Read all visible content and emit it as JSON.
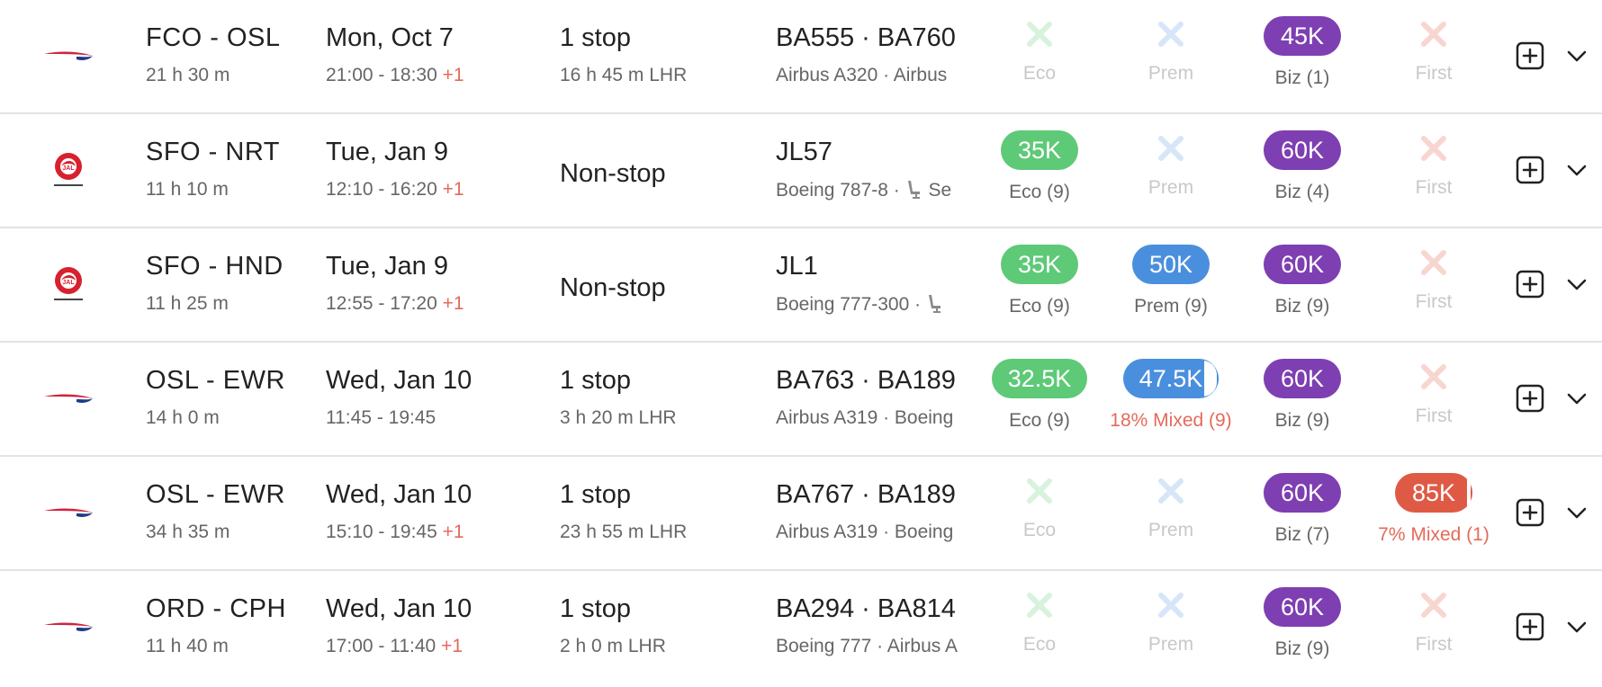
{
  "colors": {
    "eco": "#5ec977",
    "prem": "#4a8fdd",
    "biz": "#7e3fb2",
    "first": "#df5a45",
    "plus_day": "#e46a5a"
  },
  "rows": [
    {
      "airline_logo": "british-airways-logo",
      "route": "FCO - OSL",
      "duration": "21 h 30 m",
      "date": "Mon, Oct 7",
      "time_range": "21:00 - 18:30",
      "day_offset": "+1",
      "stops": "1 stop",
      "layover": "16 h 45 m  LHR",
      "flights": "BA555  ·  BA760",
      "aircraft": "Airbus A320  ·  Airbus",
      "cabins": {
        "eco": {
          "available": false,
          "label": "Eco"
        },
        "prem": {
          "available": false,
          "label": "Prem"
        },
        "biz": {
          "available": true,
          "price": "45K",
          "label": "Biz (1)"
        },
        "first": {
          "available": false,
          "label": "First"
        }
      }
    },
    {
      "airline_logo": "japan-airlines-logo",
      "route": "SFO - NRT",
      "duration": "11 h 10 m",
      "date": "Tue, Jan 9",
      "time_range": "12:10 - 16:20",
      "day_offset": "+1",
      "stops": "Non-stop",
      "layover": "",
      "flights": "JL57",
      "aircraft": "Boeing 787-8  ·",
      "aircraft_extra": "Se",
      "cabins": {
        "eco": {
          "available": true,
          "price": "35K",
          "label": "Eco (9)"
        },
        "prem": {
          "available": false,
          "label": "Prem"
        },
        "biz": {
          "available": true,
          "price": "60K",
          "label": "Biz (4)"
        },
        "first": {
          "available": false,
          "label": "First"
        }
      }
    },
    {
      "airline_logo": "japan-airlines-logo",
      "route": "SFO - HND",
      "duration": "11 h 25 m",
      "date": "Tue, Jan 9",
      "time_range": "12:55 - 17:20",
      "day_offset": "+1",
      "stops": "Non-stop",
      "layover": "",
      "flights": "JL1",
      "aircraft": "Boeing 777-300  ·",
      "aircraft_extra": "",
      "cabins": {
        "eco": {
          "available": true,
          "price": "35K",
          "label": "Eco (9)"
        },
        "prem": {
          "available": true,
          "price": "50K",
          "label": "Prem (9)"
        },
        "biz": {
          "available": true,
          "price": "60K",
          "label": "Biz (9)"
        },
        "first": {
          "available": false,
          "label": "First"
        }
      }
    },
    {
      "airline_logo": "british-airways-logo",
      "route": "OSL - EWR",
      "duration": "14 h 0 m",
      "date": "Wed, Jan 10",
      "time_range": "11:45 - 19:45",
      "day_offset": "",
      "stops": "1 stop",
      "layover": "3 h 20 m  LHR",
      "flights": "BA763  ·  BA189",
      "aircraft": "Airbus A319  ·  Boeing",
      "cabins": {
        "eco": {
          "available": true,
          "price": "32.5K",
          "label": "Eco (9)"
        },
        "prem": {
          "available": true,
          "price": "47.5K",
          "label": "18% Mixed (9)",
          "mixed_pct": 18
        },
        "biz": {
          "available": true,
          "price": "60K",
          "label": "Biz (9)"
        },
        "first": {
          "available": false,
          "label": "First"
        }
      }
    },
    {
      "airline_logo": "british-airways-logo",
      "route": "OSL - EWR",
      "duration": "34 h 35 m",
      "date": "Wed, Jan 10",
      "time_range": "15:10 - 19:45",
      "day_offset": "+1",
      "stops": "1 stop",
      "layover": "23 h 55 m  LHR",
      "flights": "BA767  ·  BA189",
      "aircraft": "Airbus A319  ·  Boeing",
      "cabins": {
        "eco": {
          "available": false,
          "label": "Eco"
        },
        "prem": {
          "available": false,
          "label": "Prem"
        },
        "biz": {
          "available": true,
          "price": "60K",
          "label": "Biz (7)"
        },
        "first": {
          "available": true,
          "price": "85K",
          "label": "7% Mixed (1)",
          "mixed_pct": 7
        }
      }
    },
    {
      "airline_logo": "british-airways-logo",
      "route": "ORD - CPH",
      "duration": "11 h 40 m",
      "date": "Wed, Jan 10",
      "time_range": "17:00 - 11:40",
      "day_offset": "+1",
      "stops": "1 stop",
      "layover": "2 h 0 m  LHR",
      "flights": "BA294  ·  BA814",
      "aircraft": "Boeing 777  ·  Airbus A",
      "cabins": {
        "eco": {
          "available": false,
          "label": "Eco"
        },
        "prem": {
          "available": false,
          "label": "Prem"
        },
        "biz": {
          "available": true,
          "price": "60K",
          "label": "Biz (9)"
        },
        "first": {
          "available": false,
          "label": "First"
        }
      }
    }
  ]
}
